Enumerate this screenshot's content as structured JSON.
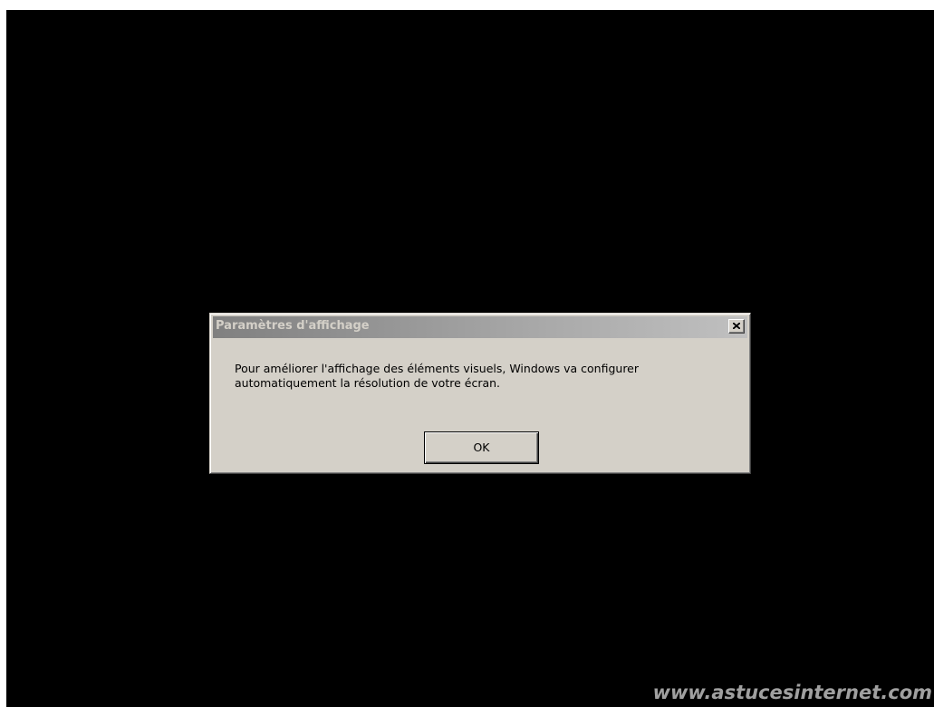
{
  "dialog": {
    "title": "Paramètres d'affichage",
    "close_icon": "close-x-icon",
    "message_line1": "Pour améliorer l'affichage des éléments visuels, Windows va configurer",
    "message_line2": "automatiquement la résolution de votre écran.",
    "ok_label": "OK"
  },
  "watermark": "www.astucesinternet.com",
  "colors": {
    "background": "#000000",
    "dialog_face": "#d4d0c8",
    "titlebar_inactive": "#808080",
    "watermark": "#a0a0a0"
  }
}
